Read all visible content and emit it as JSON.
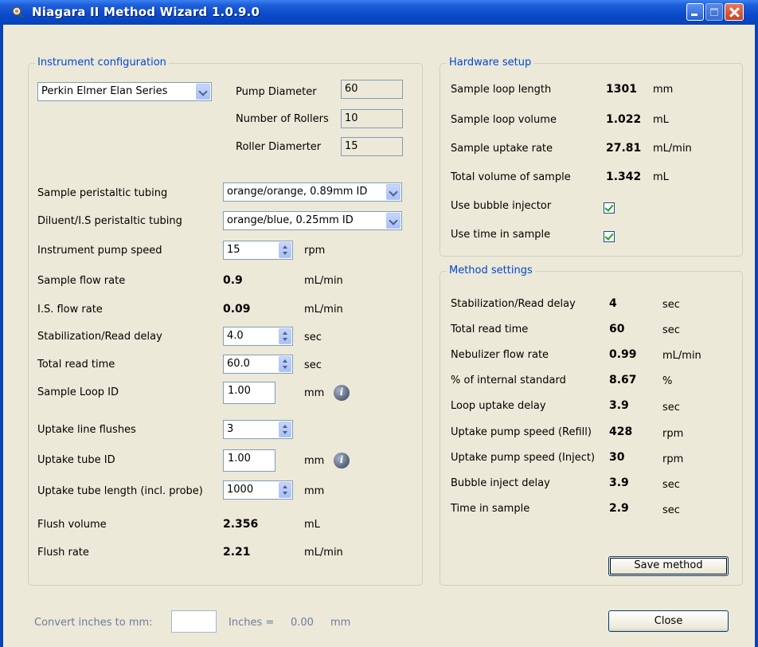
{
  "window": {
    "title": "Niagara II Method Wizard 1.0.9.0"
  },
  "instrument": {
    "legend": "Instrument configuration",
    "instrument_select": "Perkin Elmer Elan Series",
    "pump_diameter": {
      "label": "Pump Diameter",
      "value": "60"
    },
    "number_of_rollers": {
      "label": "Number of Rollers",
      "value": "10"
    },
    "roller_diameter": {
      "label": "Roller Diamerter",
      "value": "15"
    },
    "rows": {
      "sample_tubing": {
        "label": "Sample peristaltic tubing",
        "value": "orange/orange, 0.89mm ID"
      },
      "diluent_tubing": {
        "label": "Diluent/I.S peristaltic tubing",
        "value": "orange/blue, 0.25mm ID"
      },
      "pump_speed": {
        "label": "Instrument pump speed",
        "value": "15",
        "unit": "rpm"
      },
      "sample_flow": {
        "label": "Sample flow rate",
        "value": "0.9",
        "unit": "mL/min"
      },
      "is_flow": {
        "label": "I.S. flow rate",
        "value": "0.09",
        "unit": "mL/min"
      },
      "stab_delay": {
        "label": "Stabilization/Read delay",
        "value": "4.0",
        "unit": "sec"
      },
      "total_read": {
        "label": "Total read time",
        "value": "60.0",
        "unit": "sec"
      },
      "loop_id": {
        "label": "Sample Loop ID",
        "value": "1.00",
        "unit": "mm"
      },
      "flushes": {
        "label": "Uptake line flushes",
        "value": "3"
      },
      "tube_id": {
        "label": "Uptake tube ID",
        "value": "1.00",
        "unit": "mm"
      },
      "tube_length": {
        "label": "Uptake tube length (incl. probe)",
        "value": "1000",
        "unit": "mm"
      },
      "flush_volume": {
        "label": "Flush volume",
        "value": "2.356",
        "unit": "mL"
      },
      "flush_rate": {
        "label": "Flush rate",
        "value": "2.21",
        "unit": "mL/min"
      }
    }
  },
  "hardware": {
    "legend": "Hardware setup",
    "loop_length": {
      "label": "Sample loop length",
      "value": "1301",
      "unit": "mm"
    },
    "loop_volume": {
      "label": "Sample loop volume",
      "value": "1.022",
      "unit": "mL"
    },
    "uptake_rate": {
      "label": "Sample uptake rate",
      "value": "27.81",
      "unit": "mL/min"
    },
    "total_volume": {
      "label": "Total volume of sample",
      "value": "1.342",
      "unit": "mL"
    },
    "bubble_injector": {
      "label": "Use bubble injector",
      "checked": true
    },
    "time_in_sample": {
      "label": "Use time in sample",
      "checked": true
    }
  },
  "method": {
    "legend": "Method settings",
    "rows": [
      {
        "label": "Stabilization/Read delay",
        "value": "4",
        "unit": "sec"
      },
      {
        "label": "Total read time",
        "value": "60",
        "unit": "sec"
      },
      {
        "label": "Nebulizer flow rate",
        "value": "0.99",
        "unit": "mL/min"
      },
      {
        "label": "% of internal standard",
        "value": "8.67",
        "unit": "%"
      },
      {
        "label": "Loop uptake delay",
        "value": "3.9",
        "unit": "sec"
      },
      {
        "label": "Uptake pump speed (Refill)",
        "value": "428",
        "unit": "rpm"
      },
      {
        "label": "Uptake pump speed (Inject)",
        "value": "30",
        "unit": "rpm"
      },
      {
        "label": "Bubble inject delay",
        "value": "3.9",
        "unit": "sec"
      },
      {
        "label": "Time in sample",
        "value": "2.9",
        "unit": "sec"
      }
    ],
    "save_label": "Save method"
  },
  "footer": {
    "convert_label": "Convert inches to mm:",
    "inches_value": "",
    "inches_eq": "Inches =",
    "mm_value": "0.00",
    "mm_unit": "mm",
    "close_label": "Close"
  }
}
